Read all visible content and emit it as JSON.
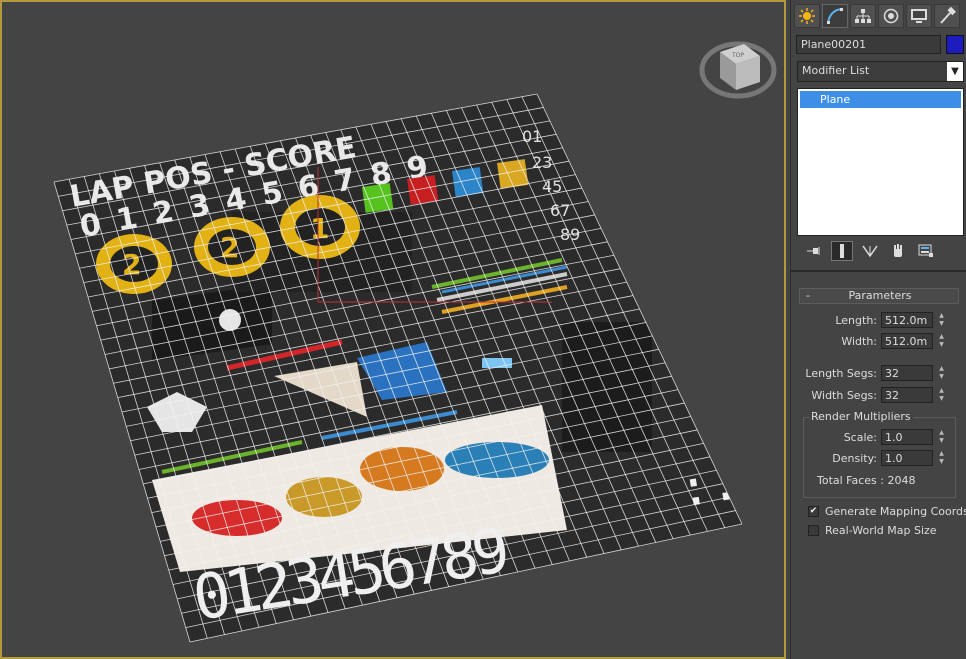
{
  "viewport": {
    "uv_template": {
      "header_text": "LAP POS - SCORE",
      "small_digits": "0123456789",
      "badges": [
        "2",
        "2",
        "1"
      ],
      "big_digits": "0123456789",
      "big_digits_end": ":.",
      "side_digits": [
        "01",
        "23",
        "45",
        "67",
        "89"
      ]
    },
    "view_cube_label": "TOP"
  },
  "command_panel": {
    "tabs": [
      {
        "name": "create-tab",
        "icon": "sun-icon"
      },
      {
        "name": "modify-tab",
        "icon": "modify-arc-icon"
      },
      {
        "name": "hierarchy-tab",
        "icon": "hierarchy-icon"
      },
      {
        "name": "motion-tab",
        "icon": "motion-icon"
      },
      {
        "name": "display-tab",
        "icon": "monitor-icon"
      },
      {
        "name": "utilities-tab",
        "icon": "hammer-icon"
      }
    ],
    "object_name": "Plane00201",
    "object_color": "#1c1cbf",
    "modifier_list": "Modifier List",
    "stack_items": [
      "Plane"
    ],
    "parameters": {
      "title": "Parameters",
      "collapse": "-",
      "length_label": "Length:",
      "length_value": "512.0m",
      "width_label": "Width:",
      "width_value": "512.0m",
      "length_segs_label": "Length Segs:",
      "length_segs_value": "32",
      "width_segs_label": "Width Segs:",
      "width_segs_value": "32",
      "render_multipliers": "Render Multipliers",
      "scale_label": "Scale:",
      "scale_value": "1.0",
      "density_label": "Density:",
      "density_value": "1.0",
      "total_faces": "Total Faces : 2048",
      "gen_mapping": "Generate Mapping Coords.",
      "gen_mapping_checked": true,
      "real_world": "Real-World Map Size",
      "real_world_checked": false
    }
  }
}
